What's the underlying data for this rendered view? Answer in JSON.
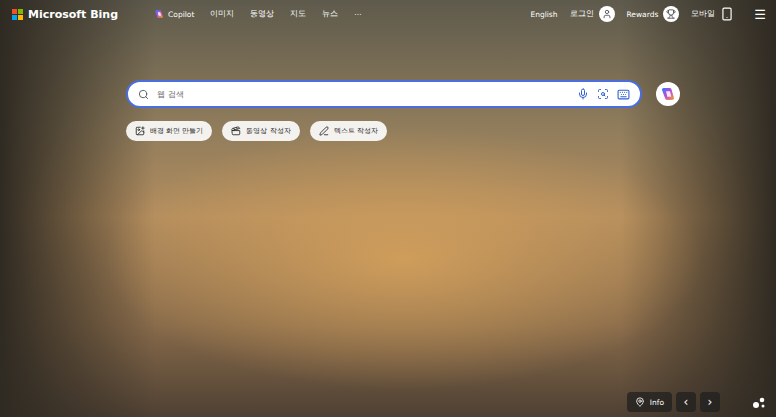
{
  "header": {
    "logo": "Microsoft Bing",
    "nav": [
      {
        "label": "Copilot",
        "kind": "copilot"
      },
      {
        "label": "이미지",
        "kind": "plain"
      },
      {
        "label": "동영상",
        "kind": "plain"
      },
      {
        "label": "지도",
        "kind": "plain"
      },
      {
        "label": "뉴스",
        "kind": "plain"
      },
      {
        "label": "···",
        "kind": "plain"
      }
    ],
    "language": "English",
    "login": "로그인",
    "rewards": "Rewards",
    "mobile": "모바일",
    "menu": "☰"
  },
  "search": {
    "placeholder": "웹 검색"
  },
  "chips": [
    {
      "label": "배경 화면 만들기",
      "kind": "image"
    },
    {
      "label": "동영상 작성자",
      "kind": "video"
    },
    {
      "label": "텍스트 작성자",
      "kind": "text"
    }
  ],
  "footer": {
    "info": "Info",
    "prev": "‹",
    "next": "›"
  }
}
